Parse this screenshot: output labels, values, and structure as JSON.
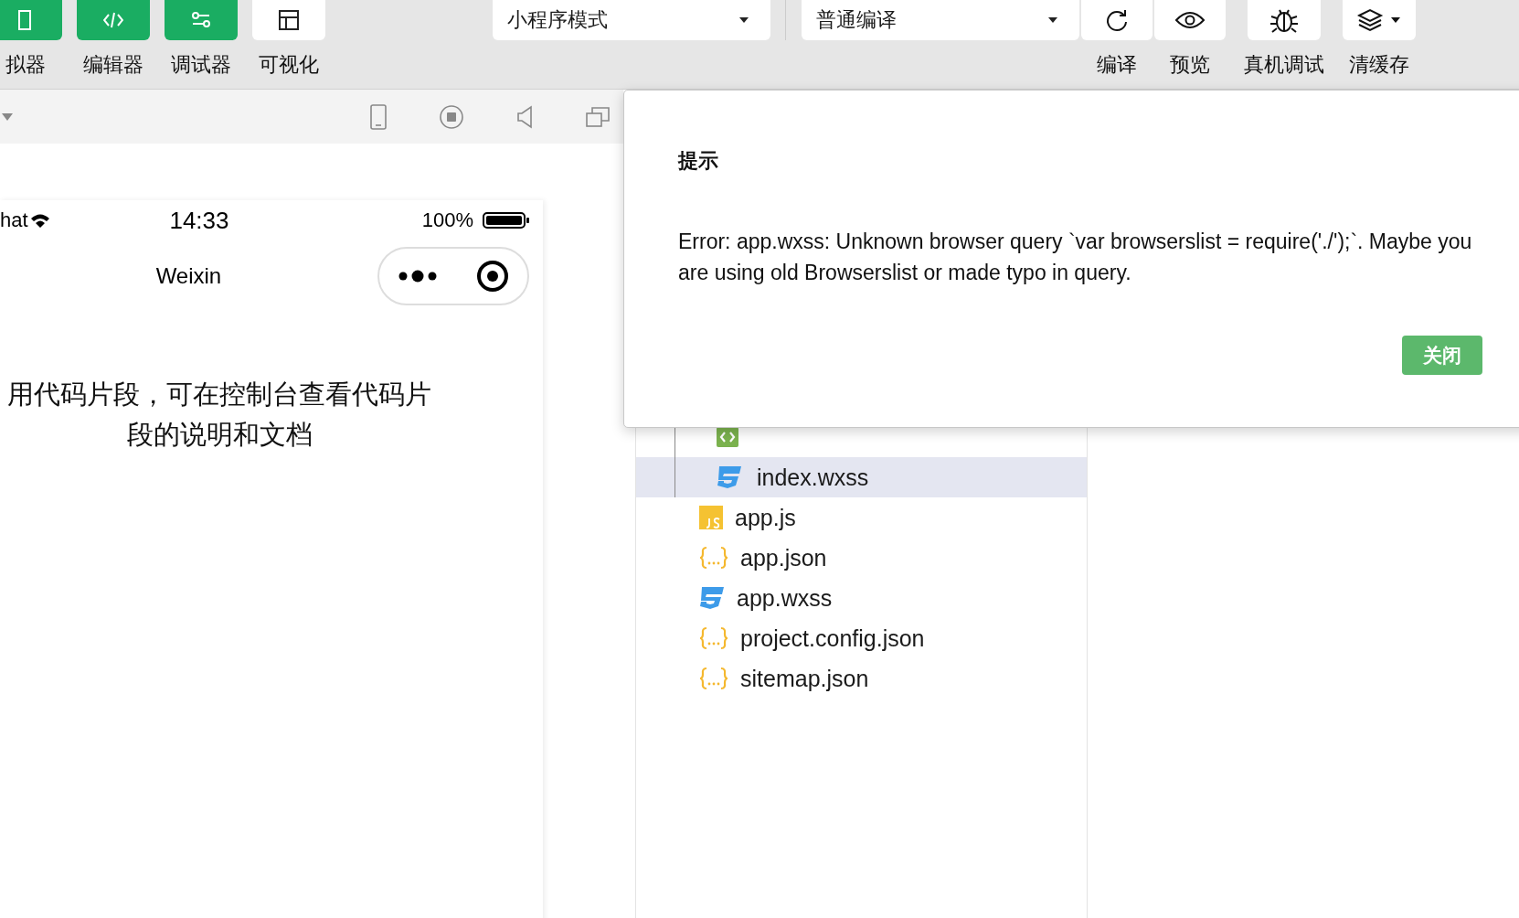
{
  "toolbar": {
    "view_buttons": [
      {
        "kind": "simulator",
        "label": "拟器",
        "selected": true
      },
      {
        "kind": "editor",
        "label": "编辑器",
        "selected": true
      },
      {
        "kind": "debugger",
        "label": "调试器",
        "selected": true
      },
      {
        "kind": "visual",
        "label": "可视化",
        "selected": false
      }
    ],
    "mode_select": {
      "value": "小程序模式"
    },
    "compile_select": {
      "value": "普通编译"
    },
    "actions": [
      {
        "kind": "compile",
        "label": "编译"
      },
      {
        "kind": "preview",
        "label": "预览"
      },
      {
        "kind": "remote-debug",
        "label": "真机调试"
      },
      {
        "kind": "clear-cache",
        "label": "清缓存"
      }
    ]
  },
  "simulator": {
    "status_bar": {
      "carrier": "hat",
      "time": "14:33",
      "battery": "100%"
    },
    "nav_title": "Weixin",
    "body_text": "用代码片段，可在控制台查看代码片段的说明和文档"
  },
  "file_tree": [
    {
      "children": [
        {
          "kind": "wxml",
          "selected": false
        },
        {
          "name": "index.wxss",
          "kind": "wxss",
          "selected": true
        }
      ]
    },
    {
      "name": "app.js",
      "kind": "js",
      "selected": false
    },
    {
      "name": "app.json",
      "kind": "json",
      "selected": false
    },
    {
      "name": "app.wxss",
      "kind": "wxss",
      "selected": false
    },
    {
      "name": "project.config.json",
      "kind": "json",
      "selected": false
    },
    {
      "name": "sitemap.json",
      "kind": "json",
      "selected": false
    }
  ],
  "dialog": {
    "title": "提示",
    "message": "Error: app.wxss: Unknown browser query `var browserslist = require('./');`. Maybe you are using old Browserslist or made typo in query.",
    "buttons": [
      "关闭"
    ]
  }
}
